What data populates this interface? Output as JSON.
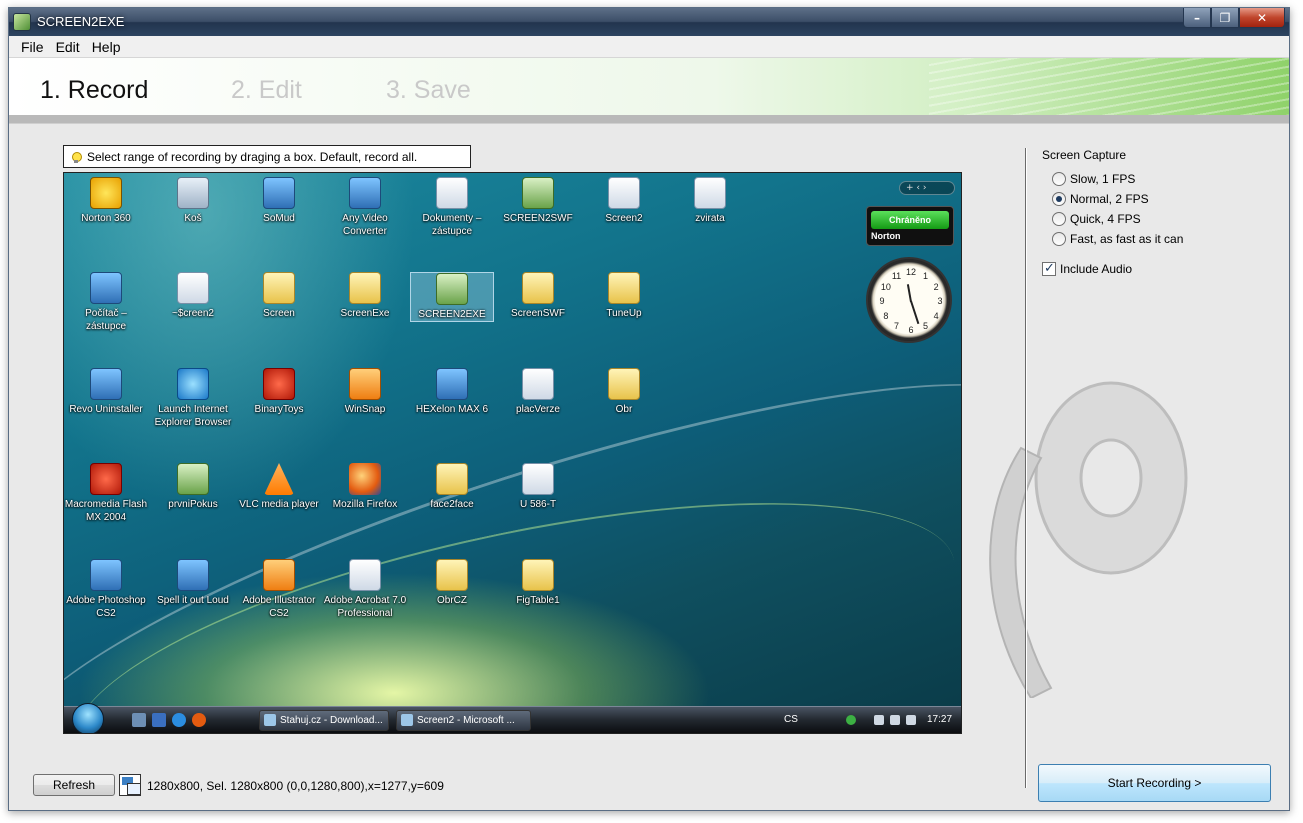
{
  "window": {
    "title": "SCREEN2EXE"
  },
  "menu": [
    "File",
    "Edit",
    "Help"
  ],
  "steps": [
    "1. Record",
    "2. Edit",
    "3. Save"
  ],
  "hint": "Select range of recording by draging a box. Default, record all.",
  "desktop": {
    "icons": [
      {
        "label": "Norton 360",
        "icon": "norton-icon",
        "style": "g-norton"
      },
      {
        "label": "Koš",
        "icon": "recycle-bin-icon",
        "style": "g-bin"
      },
      {
        "label": "SoMud",
        "icon": "app-icon",
        "style": "g-app"
      },
      {
        "label": "Any Video Converter",
        "icon": "app-icon",
        "style": "g-app"
      },
      {
        "label": "Dokumenty – zástupce",
        "icon": "document-icon",
        "style": "g-doc"
      },
      {
        "label": "SCREEN2SWF",
        "icon": "app-icon",
        "style": "g-green"
      },
      {
        "label": "Screen2",
        "icon": "document-icon",
        "style": "g-doc"
      },
      {
        "label": "zvirata",
        "icon": "document-icon",
        "style": "g-doc"
      },
      {
        "label": "Počítač – zástupce",
        "icon": "computer-icon",
        "style": "g-app"
      },
      {
        "label": "~$creen2",
        "icon": "document-icon",
        "style": "g-doc"
      },
      {
        "label": "Screen",
        "icon": "folder-icon",
        "style": "g-folder"
      },
      {
        "label": "ScreenExe",
        "icon": "folder-icon",
        "style": "g-folder"
      },
      {
        "label": "SCREEN2EXE",
        "icon": "app-icon",
        "style": "g-green"
      },
      {
        "label": "ScreenSWF",
        "icon": "folder-icon",
        "style": "g-folder"
      },
      {
        "label": "TuneUp",
        "icon": "folder-icon",
        "style": "g-folder"
      },
      {
        "label": "Revo Uninstaller",
        "icon": "app-icon",
        "style": "g-app"
      },
      {
        "label": "Launch Internet Explorer Browser",
        "icon": "ie-icon",
        "style": "g-ie"
      },
      {
        "label": "BinaryToys",
        "icon": "app-icon",
        "style": "g-red"
      },
      {
        "label": "WinSnap",
        "icon": "app-icon",
        "style": "g-orange"
      },
      {
        "label": "HEXelon MAX 6",
        "icon": "app-icon",
        "style": "g-app"
      },
      {
        "label": "placVerze",
        "icon": "vlc-file-icon",
        "style": "g-doc"
      },
      {
        "label": "Obr",
        "icon": "folder-icon",
        "style": "g-folder"
      },
      {
        "label": "Macromedia Flash MX 2004",
        "icon": "flash-icon",
        "style": "g-red"
      },
      {
        "label": "prvniPokus",
        "icon": "app-icon",
        "style": "g-green"
      },
      {
        "label": "VLC media player",
        "icon": "vlc-icon",
        "style": "g-vlc"
      },
      {
        "label": "Mozilla Firefox",
        "icon": "firefox-icon",
        "style": "g-ff"
      },
      {
        "label": "face2face",
        "icon": "folder-icon",
        "style": "g-folder"
      },
      {
        "label": "U 586-T",
        "icon": "document-icon",
        "style": "g-doc"
      },
      {
        "label": "Adobe Photoshop CS2",
        "icon": "photoshop-icon",
        "style": "g-app"
      },
      {
        "label": "Spell it out Loud",
        "icon": "app-icon",
        "style": "g-app"
      },
      {
        "label": "Adobe Illustrator CS2",
        "icon": "illustrator-icon",
        "style": "g-orange"
      },
      {
        "label": "Adobe Acrobat 7.0 Professional",
        "icon": "acrobat-icon",
        "style": "g-doc"
      },
      {
        "label": "ObrCZ",
        "icon": "folder-icon",
        "style": "g-folder"
      },
      {
        "label": "FigTable1",
        "icon": "folder-icon",
        "style": "g-folder"
      }
    ],
    "norton_status": "Chráněno",
    "norton_brand": "Norton",
    "clock_numbers": [
      "12",
      "1",
      "2",
      "3",
      "4",
      "5",
      "6",
      "7",
      "8",
      "9",
      "10",
      "11"
    ],
    "gadget_toolbar": "+  ‹  ›",
    "taskbar": {
      "tasks": [
        "Stahuj.cz - Download...",
        "Screen2 - Microsoft ..."
      ],
      "language": "CS",
      "time": "17:27"
    }
  },
  "right_panel": {
    "group_title": "Screen Capture",
    "options": [
      {
        "label": "Slow, 1 FPS",
        "checked": false
      },
      {
        "label": "Normal, 2 FPS",
        "checked": true
      },
      {
        "label": "Quick, 4 FPS",
        "checked": false
      },
      {
        "label": "Fast, as fast as it can",
        "checked": false
      }
    ],
    "include_audio": {
      "label": "Include Audio",
      "checked": true
    },
    "start_button": "Start Recording >"
  },
  "bottom": {
    "refresh": "Refresh",
    "status": "1280x800, Sel. 1280x800 (0,0,1280,800),x=1277,y=609"
  }
}
